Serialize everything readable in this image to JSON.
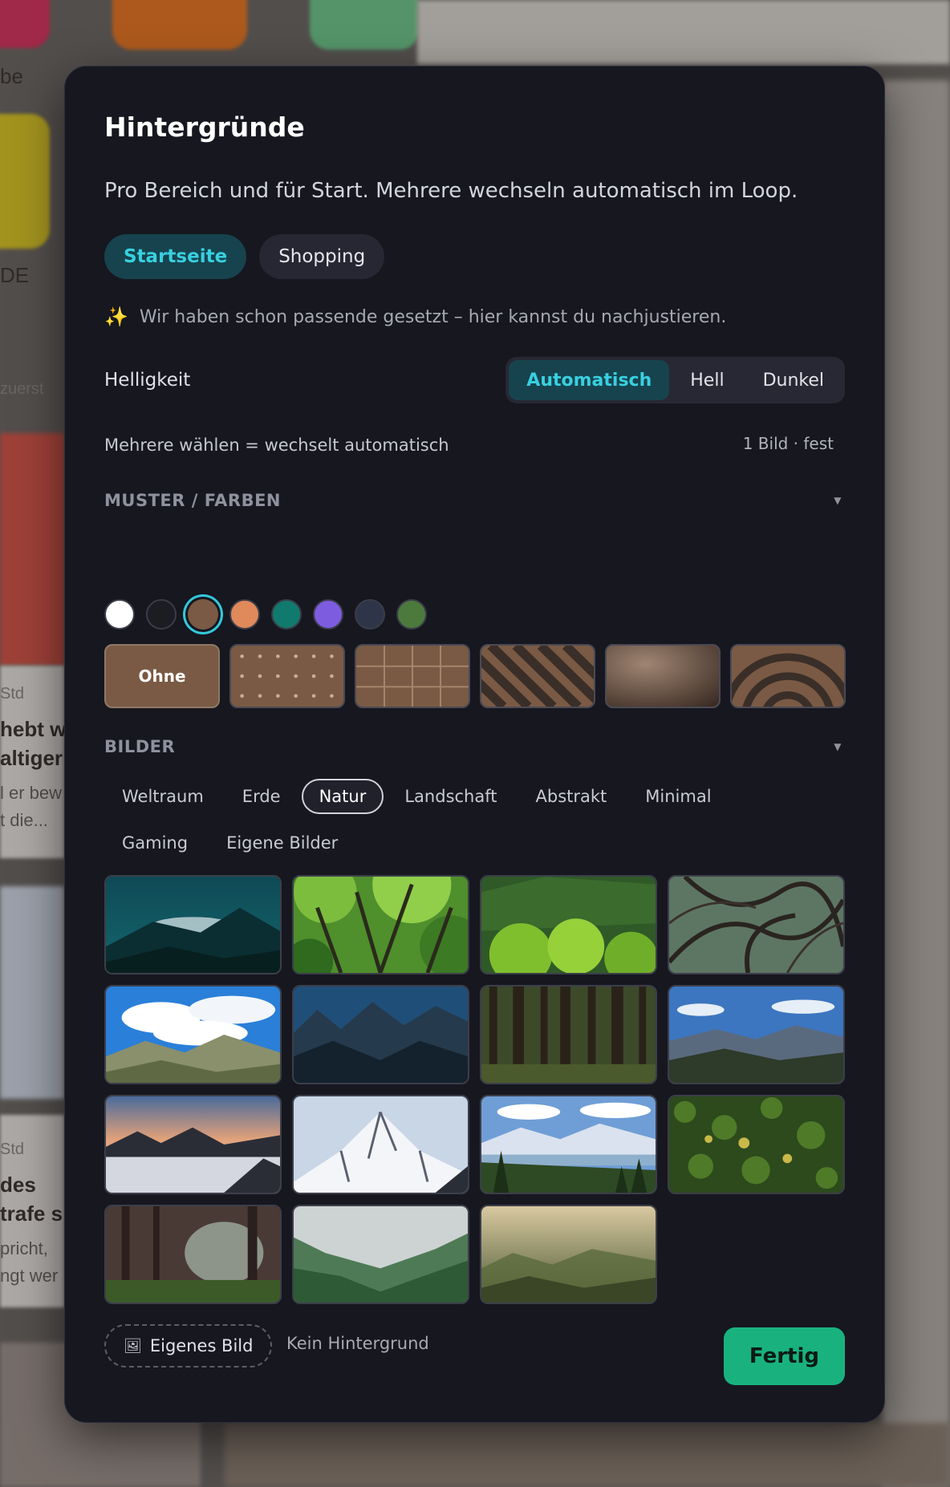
{
  "background_app": {
    "texts": [
      "be",
      "DE",
      "zuerst",
      "Std",
      "hebt we",
      "altiger N",
      "l er bew",
      "t die...",
      "Std",
      "des",
      "trafe s",
      "pricht,",
      "ngt wer"
    ]
  },
  "modal": {
    "title": "Hintergründe",
    "subtitle": "Pro Bereich und für Start. Mehrere wechseln automatisch im Loop.",
    "area_tabs": [
      {
        "label": "Startseite",
        "active": true
      },
      {
        "label": "Shopping",
        "active": false
      }
    ],
    "hint": {
      "icon": "sparkle-icon",
      "text": "Wir haben schon passende gesetzt – hier kannst du nachjustieren."
    },
    "brightness": {
      "label": "Helligkeit",
      "options": [
        {
          "label": "Automatisch",
          "active": true
        },
        {
          "label": "Hell",
          "active": false
        },
        {
          "label": "Dunkel",
          "active": false
        }
      ]
    },
    "multi_select": {
      "label": "Mehrere wählen = wechselt automatisch",
      "count": "1 Bild · fest"
    },
    "patterns_section": {
      "title": "MUSTER / FARBEN",
      "swatches": [
        {
          "color": "#ffffff",
          "selected": false
        },
        {
          "color": "#1c1d22",
          "selected": false
        },
        {
          "color": "#7a5a44",
          "selected": true
        },
        {
          "color": "#e0895a",
          "selected": false
        },
        {
          "color": "#117a6e",
          "selected": false
        },
        {
          "color": "#7d5ce0",
          "selected": false
        },
        {
          "color": "#2f3548",
          "selected": false
        },
        {
          "color": "#4c7a3c",
          "selected": false
        }
      ],
      "patterns": [
        {
          "name": "none",
          "label": "Ohne",
          "selected": true
        },
        {
          "name": "dots",
          "label": ""
        },
        {
          "name": "grid",
          "label": ""
        },
        {
          "name": "stripes",
          "label": ""
        },
        {
          "name": "gradient",
          "label": ""
        },
        {
          "name": "waves",
          "label": ""
        }
      ]
    },
    "images_section": {
      "title": "BILDER",
      "categories": [
        {
          "label": "Weltraum",
          "active": false
        },
        {
          "label": "Erde",
          "active": false
        },
        {
          "label": "Natur",
          "active": true
        },
        {
          "label": "Landschaft",
          "active": false
        },
        {
          "label": "Abstrakt",
          "active": false
        },
        {
          "label": "Minimal",
          "active": false
        },
        {
          "label": "Gaming",
          "active": false
        },
        {
          "label": "Eigene Bilder",
          "active": false
        }
      ],
      "images": [
        {
          "name": "teal-mountain-mist"
        },
        {
          "name": "green-tree-canopy"
        },
        {
          "name": "forest-hills"
        },
        {
          "name": "twisted-branches"
        },
        {
          "name": "blue-sky-alps"
        },
        {
          "name": "dark-blue-peaks"
        },
        {
          "name": "pine-trunks"
        },
        {
          "name": "valley-panorama"
        },
        {
          "name": "sunset-sea-of-clouds"
        },
        {
          "name": "snowy-peak"
        },
        {
          "name": "lake-valley-pines"
        },
        {
          "name": "aerial-forest"
        },
        {
          "name": "misty-forest-path"
        },
        {
          "name": "foggy-forest-valley"
        },
        {
          "name": "golden-fog-forest"
        }
      ]
    },
    "own_image": {
      "icon": "picture-icon",
      "label": "Eigenes Bild"
    },
    "no_background": "Kein Hintergrund",
    "done": "Fertig"
  }
}
